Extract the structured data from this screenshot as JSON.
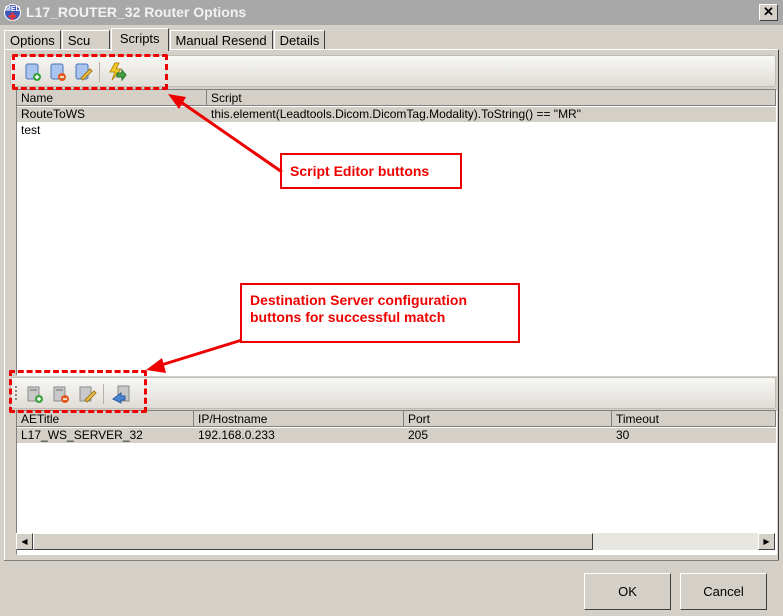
{
  "window": {
    "title": "L17_ROUTER_32 Router Options",
    "icon_label": "MED",
    "close_label": "✕"
  },
  "tabs": [
    {
      "label": "Options",
      "active": false
    },
    {
      "label": "Scu",
      "active": false
    },
    {
      "label": "Scripts",
      "active": true
    },
    {
      "label": "Manual Resend",
      "active": false
    },
    {
      "label": "Details",
      "active": false
    }
  ],
  "script_toolbar": {
    "buttons": [
      {
        "icon": "add-script-icon",
        "tooltip": "Add Script"
      },
      {
        "icon": "remove-script-icon",
        "tooltip": "Remove Script"
      },
      {
        "icon": "edit-script-icon",
        "tooltip": "Edit Script"
      },
      {
        "icon": "run-script-icon",
        "tooltip": "Execute Script"
      }
    ]
  },
  "scripts_table": {
    "columns": [
      "Name",
      "Script"
    ],
    "rows": [
      {
        "name": "RouteToWS",
        "script": "this.element(Leadtools.Dicom.DicomTag.Modality).ToString() == \"MR\"",
        "selected": true
      },
      {
        "name": "test",
        "script": "",
        "selected": false
      }
    ]
  },
  "server_toolbar": {
    "buttons": [
      {
        "icon": "add-server-icon"
      },
      {
        "icon": "remove-server-icon"
      },
      {
        "icon": "edit-server-icon"
      },
      {
        "icon": "verify-server-icon"
      }
    ]
  },
  "servers_table": {
    "columns": [
      "AETitle",
      "IP/Hostname",
      "Port",
      "Timeout"
    ],
    "rows": [
      {
        "aetitle": "L17_WS_SERVER_32",
        "host": "192.168.0.233",
        "port": "205",
        "timeout": "30",
        "selected": true
      }
    ]
  },
  "footer": {
    "ok_label": "OK",
    "cancel_label": "Cancel"
  },
  "annotations": {
    "script_editor": "Script Editor buttons",
    "destination_line1": "Destination Server configuration",
    "destination_line2": "buttons for successful match",
    "color": "#e00000"
  },
  "scroll": {
    "left_arrow": "◀",
    "right_arrow": "▶"
  }
}
